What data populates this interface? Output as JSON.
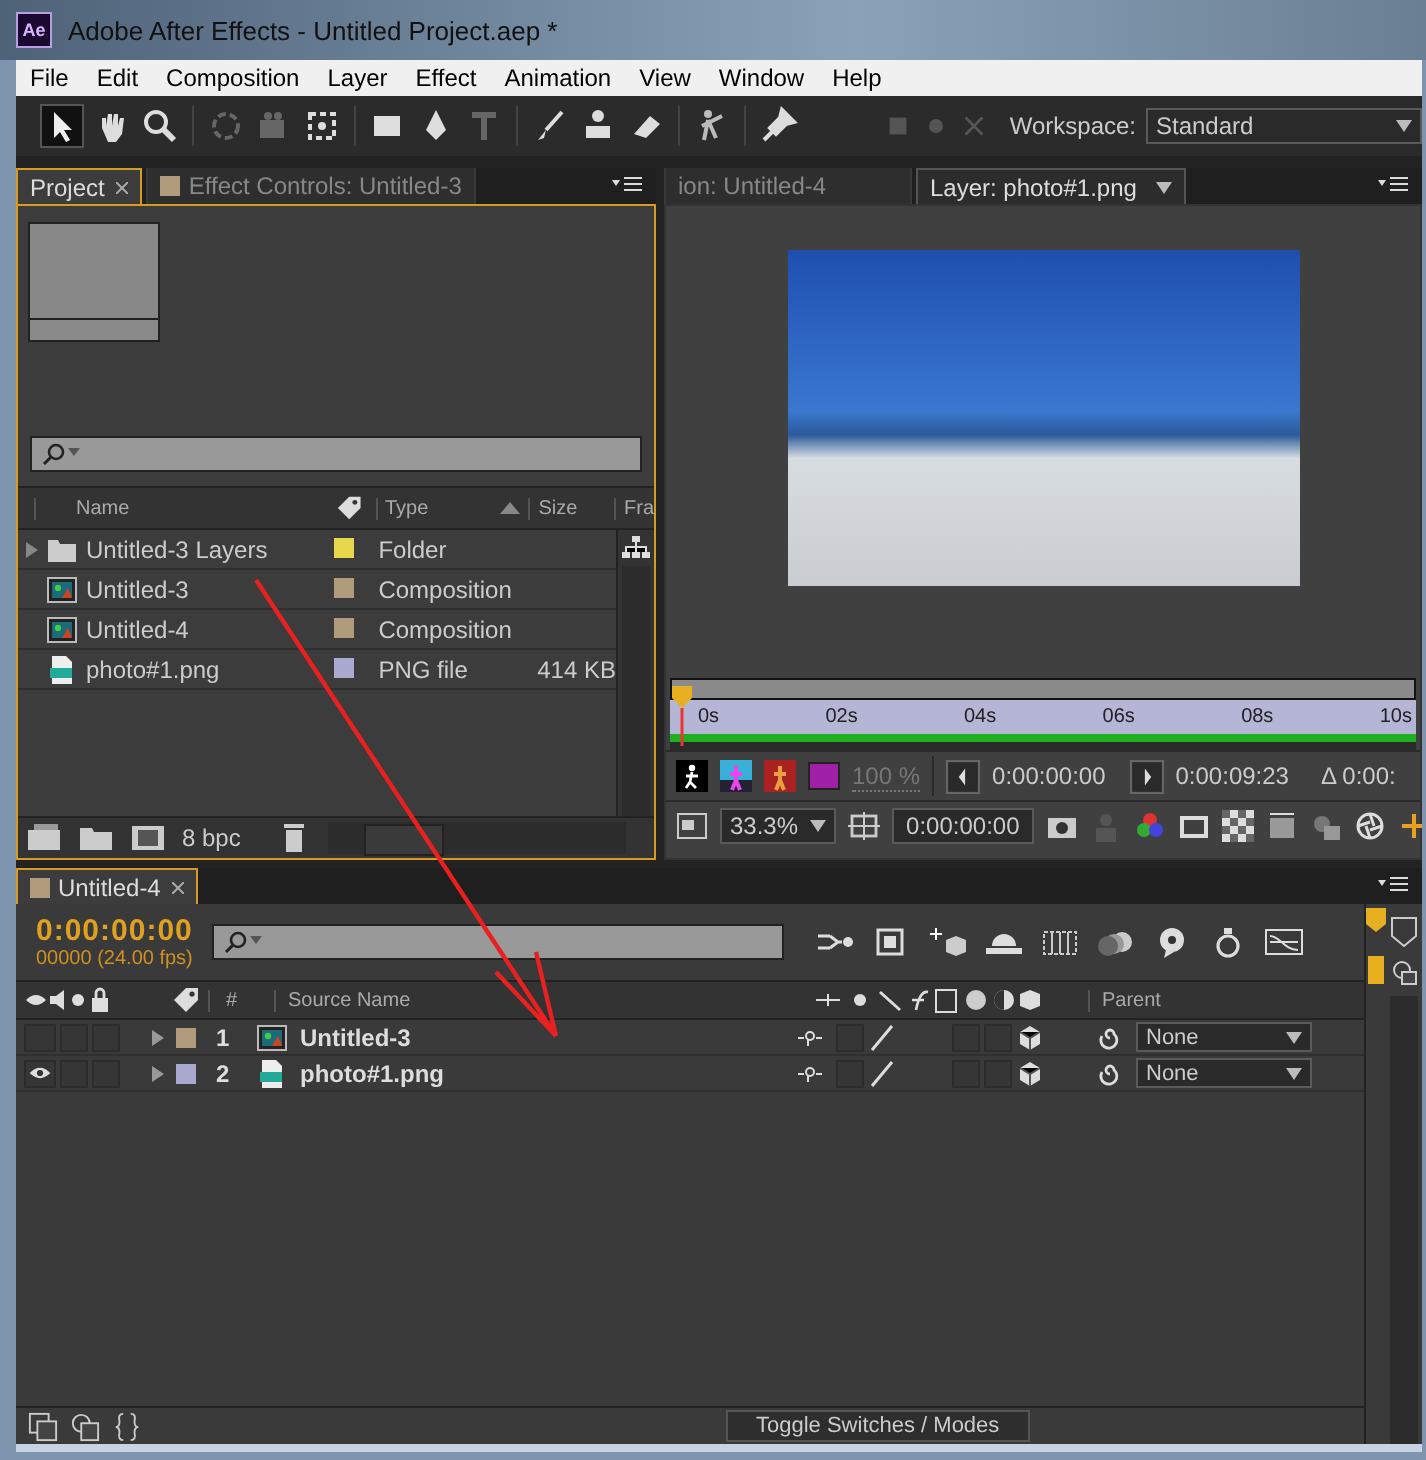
{
  "window": {
    "app_icon": "Ae",
    "title": "Adobe After Effects - Untitled Project.aep *"
  },
  "menu": [
    "File",
    "Edit",
    "Composition",
    "Layer",
    "Effect",
    "Animation",
    "View",
    "Window",
    "Help"
  ],
  "toolbar": {
    "workspace_label": "Workspace:",
    "workspace_value": "Standard"
  },
  "project_panel": {
    "tabs": [
      {
        "label": "Project",
        "selected": true
      },
      {
        "label": "Effect Controls: Untitled-3",
        "selected": false,
        "color": "#b09c7c"
      }
    ],
    "columns": [
      "Name",
      "Type",
      "Size",
      "Fra"
    ],
    "items": [
      {
        "kind": "folder",
        "name": "Untitled-3 Layers",
        "color": "#e6d84a",
        "type": "Folder"
      },
      {
        "kind": "comp",
        "name": "Untitled-3",
        "color": "#b09c7c",
        "type": "Composition"
      },
      {
        "kind": "comp",
        "name": "Untitled-4",
        "color": "#b09c7c",
        "type": "Composition"
      },
      {
        "kind": "png",
        "name": "photo#1.png",
        "color": "#aaaad0",
        "type": "PNG file",
        "size": "414 KB"
      }
    ],
    "bpc": "8 bpc"
  },
  "viewer": {
    "tabs": [
      {
        "label": "ion: Untitled-4",
        "selected": false
      },
      {
        "label": "Layer: photo#1.png",
        "selected": true
      }
    ],
    "ruler": [
      "0s",
      "02s",
      "04s",
      "06s",
      "08s",
      "10s"
    ],
    "opacity": "100 %",
    "in_time": "0:00:00:00",
    "out_time": "0:00:09:23",
    "duration": "Δ 0:00:",
    "zoom": "33.3%",
    "current_time": "0:00:00:00"
  },
  "timeline": {
    "tab": "Untitled-4",
    "time": "0:00:00:00",
    "frames": "00000 (24.00 fps)",
    "col_number": "#",
    "col_source": "Source Name",
    "col_parent": "Parent",
    "layers": [
      {
        "index": "1",
        "name": "Untitled-3",
        "kind": "comp",
        "color": "#b09c7c",
        "visible": false,
        "solo": false,
        "locked": false,
        "shy": false,
        "collapse": false,
        "effects": false,
        "motion_blur": false,
        "parent": "None"
      },
      {
        "index": "2",
        "name": "photo#1.png",
        "kind": "png",
        "color": "#aaaad0",
        "visible": true,
        "solo": false,
        "locked": false,
        "shy": false,
        "collapse": false,
        "effects": false,
        "motion_blur": false,
        "parent": "None"
      }
    ],
    "toggle": "Toggle Switches / Modes"
  }
}
